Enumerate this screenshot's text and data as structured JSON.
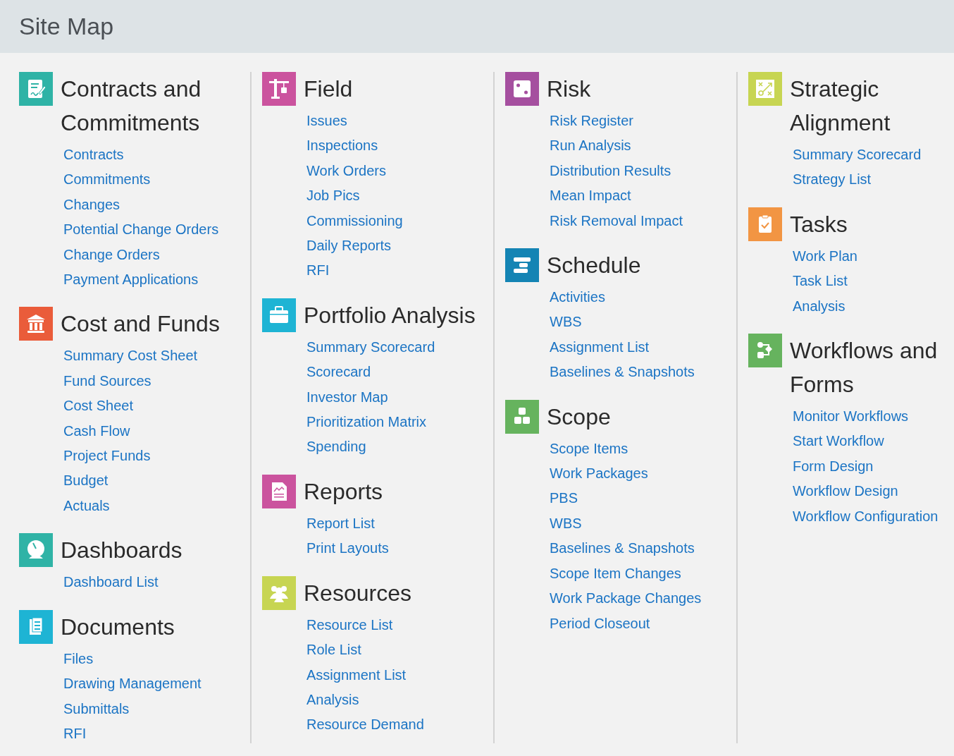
{
  "header": {
    "title": "Site Map"
  },
  "columns": [
    {
      "sections": [
        {
          "kind": "contract",
          "color": "#2fb3a6",
          "title": "Contracts and Commitments",
          "links": [
            "Contracts",
            "Commitments",
            "Changes",
            "Potential Change Orders",
            "Change Orders",
            "Payment Applications"
          ]
        },
        {
          "kind": "bank",
          "color": "#ea5c3a",
          "title": "Cost and Funds",
          "links": [
            "Summary Cost Sheet",
            "Fund Sources",
            "Cost Sheet",
            "Cash Flow",
            "Project Funds",
            "Budget",
            "Actuals"
          ]
        },
        {
          "kind": "gauge",
          "color": "#2fb3a6",
          "title": "Dashboards",
          "links": [
            "Dashboard List"
          ]
        },
        {
          "kind": "documents",
          "color": "#1eb4d4",
          "title": "Documents",
          "links": [
            "Files",
            "Drawing Management",
            "Submittals",
            "RFI"
          ]
        }
      ]
    },
    {
      "sections": [
        {
          "kind": "crane",
          "color": "#cb539e",
          "title": "Field",
          "links": [
            "Issues",
            "Inspections",
            "Work Orders",
            "Job Pics",
            "Commissioning",
            "Daily Reports",
            "RFI"
          ]
        },
        {
          "kind": "briefcase",
          "color": "#1eb4d4",
          "title": "Portfolio Analysis",
          "links": [
            "Summary Scorecard",
            "Scorecard",
            "Investor Map",
            "Prioritization Matrix",
            "Spending"
          ]
        },
        {
          "kind": "report",
          "color": "#cb539e",
          "title": "Reports",
          "links": [
            "Report List",
            "Print Layouts"
          ]
        },
        {
          "kind": "people",
          "color": "#c7d552",
          "title": "Resources",
          "links": [
            "Resource List",
            "Role List",
            "Assignment List",
            "Analysis",
            "Resource Demand"
          ]
        }
      ]
    },
    {
      "sections": [
        {
          "kind": "dice",
          "color": "#a54f9f",
          "title": "Risk",
          "links": [
            "Risk Register",
            "Run Analysis",
            "Distribution Results",
            "Mean Impact",
            "Risk Removal Impact"
          ]
        },
        {
          "kind": "gantt",
          "color": "#1484b4",
          "title": "Schedule",
          "links": [
            "Activities",
            "WBS",
            "Assignment List",
            "Baselines & Snapshots"
          ]
        },
        {
          "kind": "blocks",
          "color": "#66b35e",
          "title": "Scope",
          "links": [
            "Scope Items",
            "Work Packages",
            "PBS",
            "WBS",
            "Baselines & Snapshots",
            "Scope Item Changes",
            "Work Package Changes",
            "Period Closeout"
          ]
        }
      ]
    },
    {
      "sections": [
        {
          "kind": "strategy",
          "color": "#c7d552",
          "title": "Strategic Alignment",
          "links": [
            "Summary Scorecard",
            "Strategy List"
          ]
        },
        {
          "kind": "clipboard",
          "color": "#f29543",
          "title": "Tasks",
          "links": [
            "Work Plan",
            "Task List",
            "Analysis"
          ]
        },
        {
          "kind": "flow",
          "color": "#66b35e",
          "title": "Workflows and Forms",
          "links": [
            "Monitor Workflows",
            "Start Workflow",
            "Form Design",
            "Workflow Design",
            "Workflow Configuration"
          ]
        }
      ]
    }
  ]
}
